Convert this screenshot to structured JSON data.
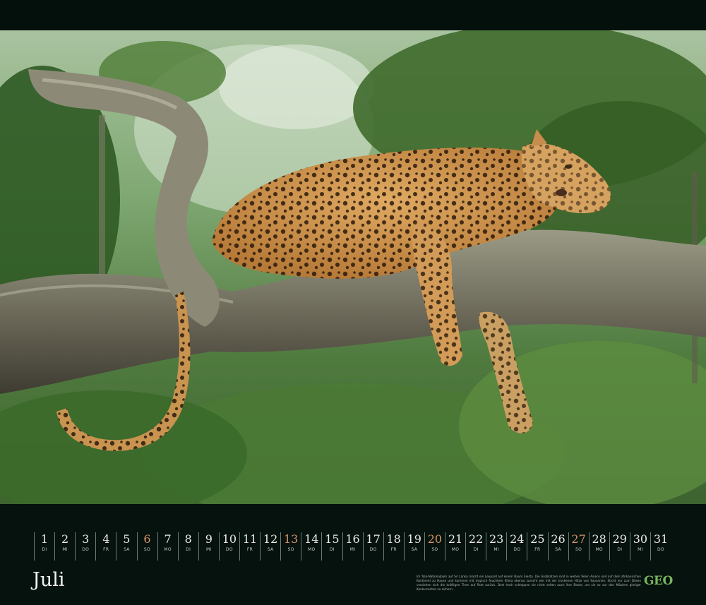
{
  "calendar": {
    "month": "Juli",
    "days": [
      {
        "n": "1",
        "wd": "DI",
        "weekend": false
      },
      {
        "n": "2",
        "wd": "MI",
        "weekend": false
      },
      {
        "n": "3",
        "wd": "DO",
        "weekend": false
      },
      {
        "n": "4",
        "wd": "FR",
        "weekend": false
      },
      {
        "n": "5",
        "wd": "SA",
        "weekend": false
      },
      {
        "n": "6",
        "wd": "SO",
        "weekend": true
      },
      {
        "n": "7",
        "wd": "MO",
        "weekend": false
      },
      {
        "n": "8",
        "wd": "DI",
        "weekend": false
      },
      {
        "n": "9",
        "wd": "MI",
        "weekend": false
      },
      {
        "n": "10",
        "wd": "DO",
        "weekend": false
      },
      {
        "n": "11",
        "wd": "FR",
        "weekend": false
      },
      {
        "n": "12",
        "wd": "SA",
        "weekend": false
      },
      {
        "n": "13",
        "wd": "SO",
        "weekend": true
      },
      {
        "n": "14",
        "wd": "MO",
        "weekend": false
      },
      {
        "n": "15",
        "wd": "DI",
        "weekend": false
      },
      {
        "n": "16",
        "wd": "MI",
        "weekend": false
      },
      {
        "n": "17",
        "wd": "DO",
        "weekend": false
      },
      {
        "n": "18",
        "wd": "FR",
        "weekend": false
      },
      {
        "n": "19",
        "wd": "SA",
        "weekend": false
      },
      {
        "n": "20",
        "wd": "SO",
        "weekend": true
      },
      {
        "n": "21",
        "wd": "MO",
        "weekend": false
      },
      {
        "n": "22",
        "wd": "DI",
        "weekend": false
      },
      {
        "n": "23",
        "wd": "MI",
        "weekend": false
      },
      {
        "n": "24",
        "wd": "DO",
        "weekend": false
      },
      {
        "n": "25",
        "wd": "FR",
        "weekend": false
      },
      {
        "n": "26",
        "wd": "SA",
        "weekend": false
      },
      {
        "n": "27",
        "wd": "SO",
        "weekend": true
      },
      {
        "n": "28",
        "wd": "MO",
        "weekend": false
      },
      {
        "n": "29",
        "wd": "DI",
        "weekend": false
      },
      {
        "n": "30",
        "wd": "MI",
        "weekend": false
      },
      {
        "n": "31",
        "wd": "DO",
        "weekend": false
      }
    ],
    "caption": "Im Yala-Nationalpark auf Sri Lanka macht ein Leopard auf einem Baum Siesta. Die Großkatzen sind in weiten Teilen Asiens und auf dem afrikanischen Kontinent zu Hause und kommen mit tropisch feuchtem Klima ebenso zurecht wie mit der trockenen Hitze von Savannen. Sticht nur zum Dösen verziehen sich die kräftigen Tiere auf Äste zurück. Dort hoch schleppen sie nicht selten auch ihre Beute, um sie so vor den Mäulern gieriger Konkurrenten zu sichern",
    "brand": "GEO"
  },
  "colors": {
    "background": "#05100d",
    "weekend_number": "#d79466",
    "brand": "#79b65d"
  }
}
